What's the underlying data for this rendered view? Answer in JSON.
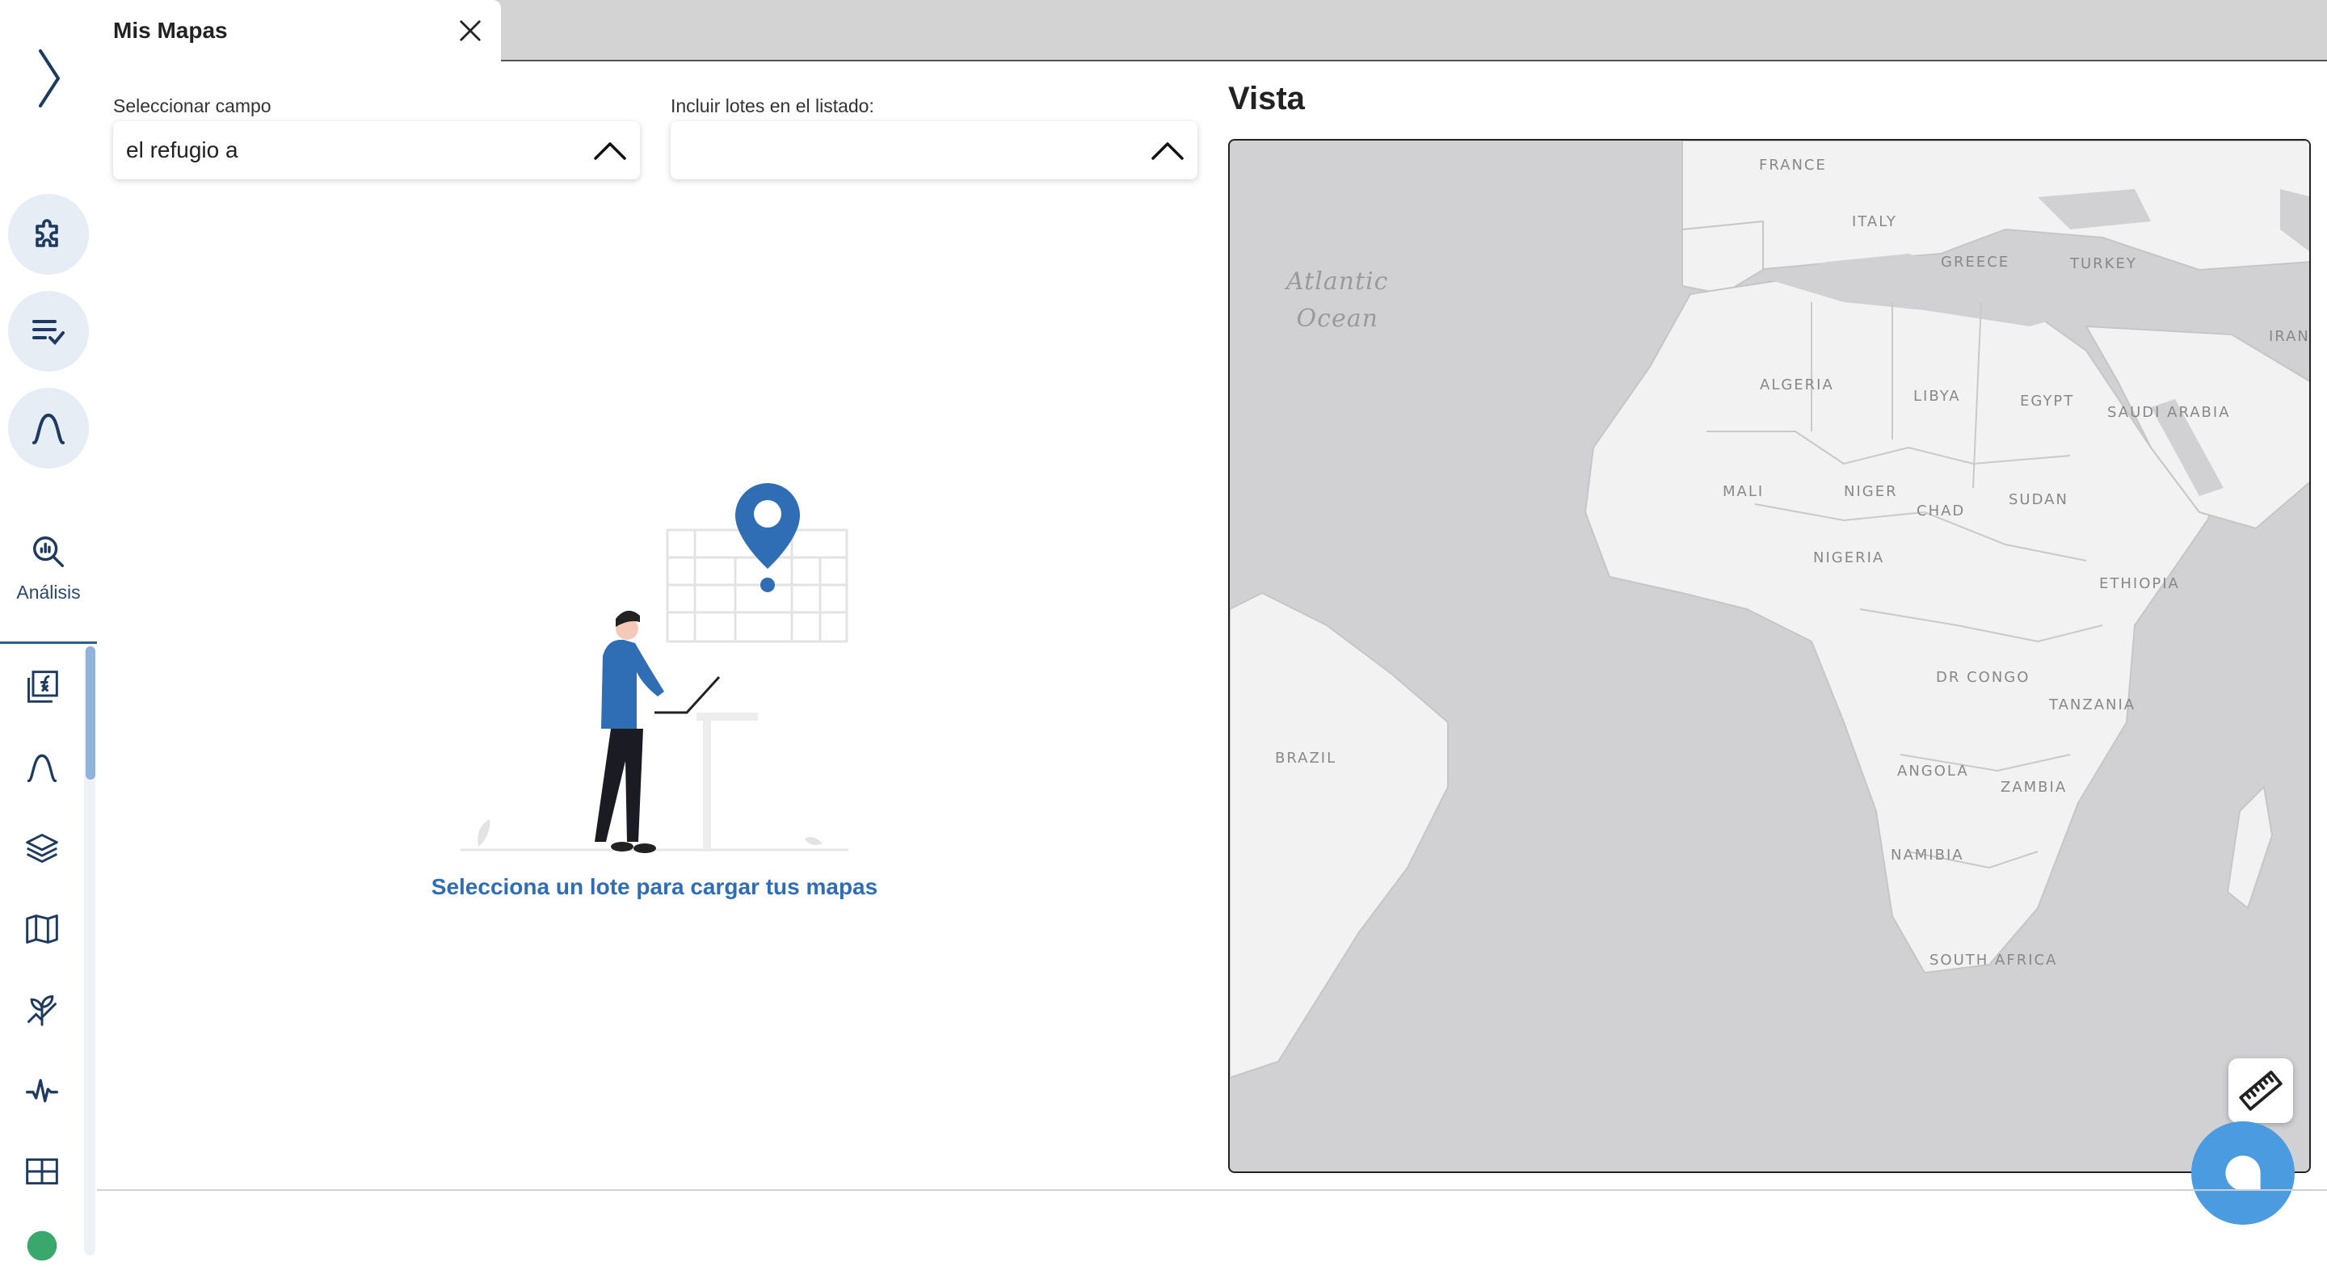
{
  "tab": {
    "title": "Mis Mapas"
  },
  "sidebar": {
    "analysis_label": "Análisis",
    "icons": [
      "chevron-right-icon",
      "puzzle-icon",
      "list-check-icon",
      "bell-curve-icon",
      "analysis-search-icon",
      "function-chart-icon",
      "bell-curve-icon",
      "layers-icon",
      "map-icon",
      "plant-growth-icon",
      "pulse-icon",
      "table-icon"
    ]
  },
  "form": {
    "field_label": "Seleccionar campo",
    "field_value": "el refugio a",
    "lots_label": "Incluir lotes en el listado:",
    "lots_value": ""
  },
  "empty_state": {
    "message": "Selecciona un lote para cargar tus mapas"
  },
  "vista": {
    "title": "Vista",
    "ocean_label": [
      "Atlantic",
      "Ocean"
    ],
    "countries": [
      "FRANCE",
      "ITALY",
      "GREECE",
      "TURKEY",
      "IRAN",
      "ALGERIA",
      "LIBYA",
      "EGYPT",
      "SAUDI ARABIA",
      "MALI",
      "NIGER",
      "CHAD",
      "SUDAN",
      "NIGERIA",
      "ETHIOPIA",
      "DR CONGO",
      "TANZANIA",
      "BRAZIL",
      "ANGOLA",
      "ZAMBIA",
      "NAMIBIA",
      "SOUTH AFRICA"
    ]
  },
  "colors": {
    "accent": "#2f6db5",
    "sidebar_button": "#e6edf4",
    "chat": "#4a9be0",
    "water": "#d1d1d4",
    "land": "#f2f2f2"
  }
}
